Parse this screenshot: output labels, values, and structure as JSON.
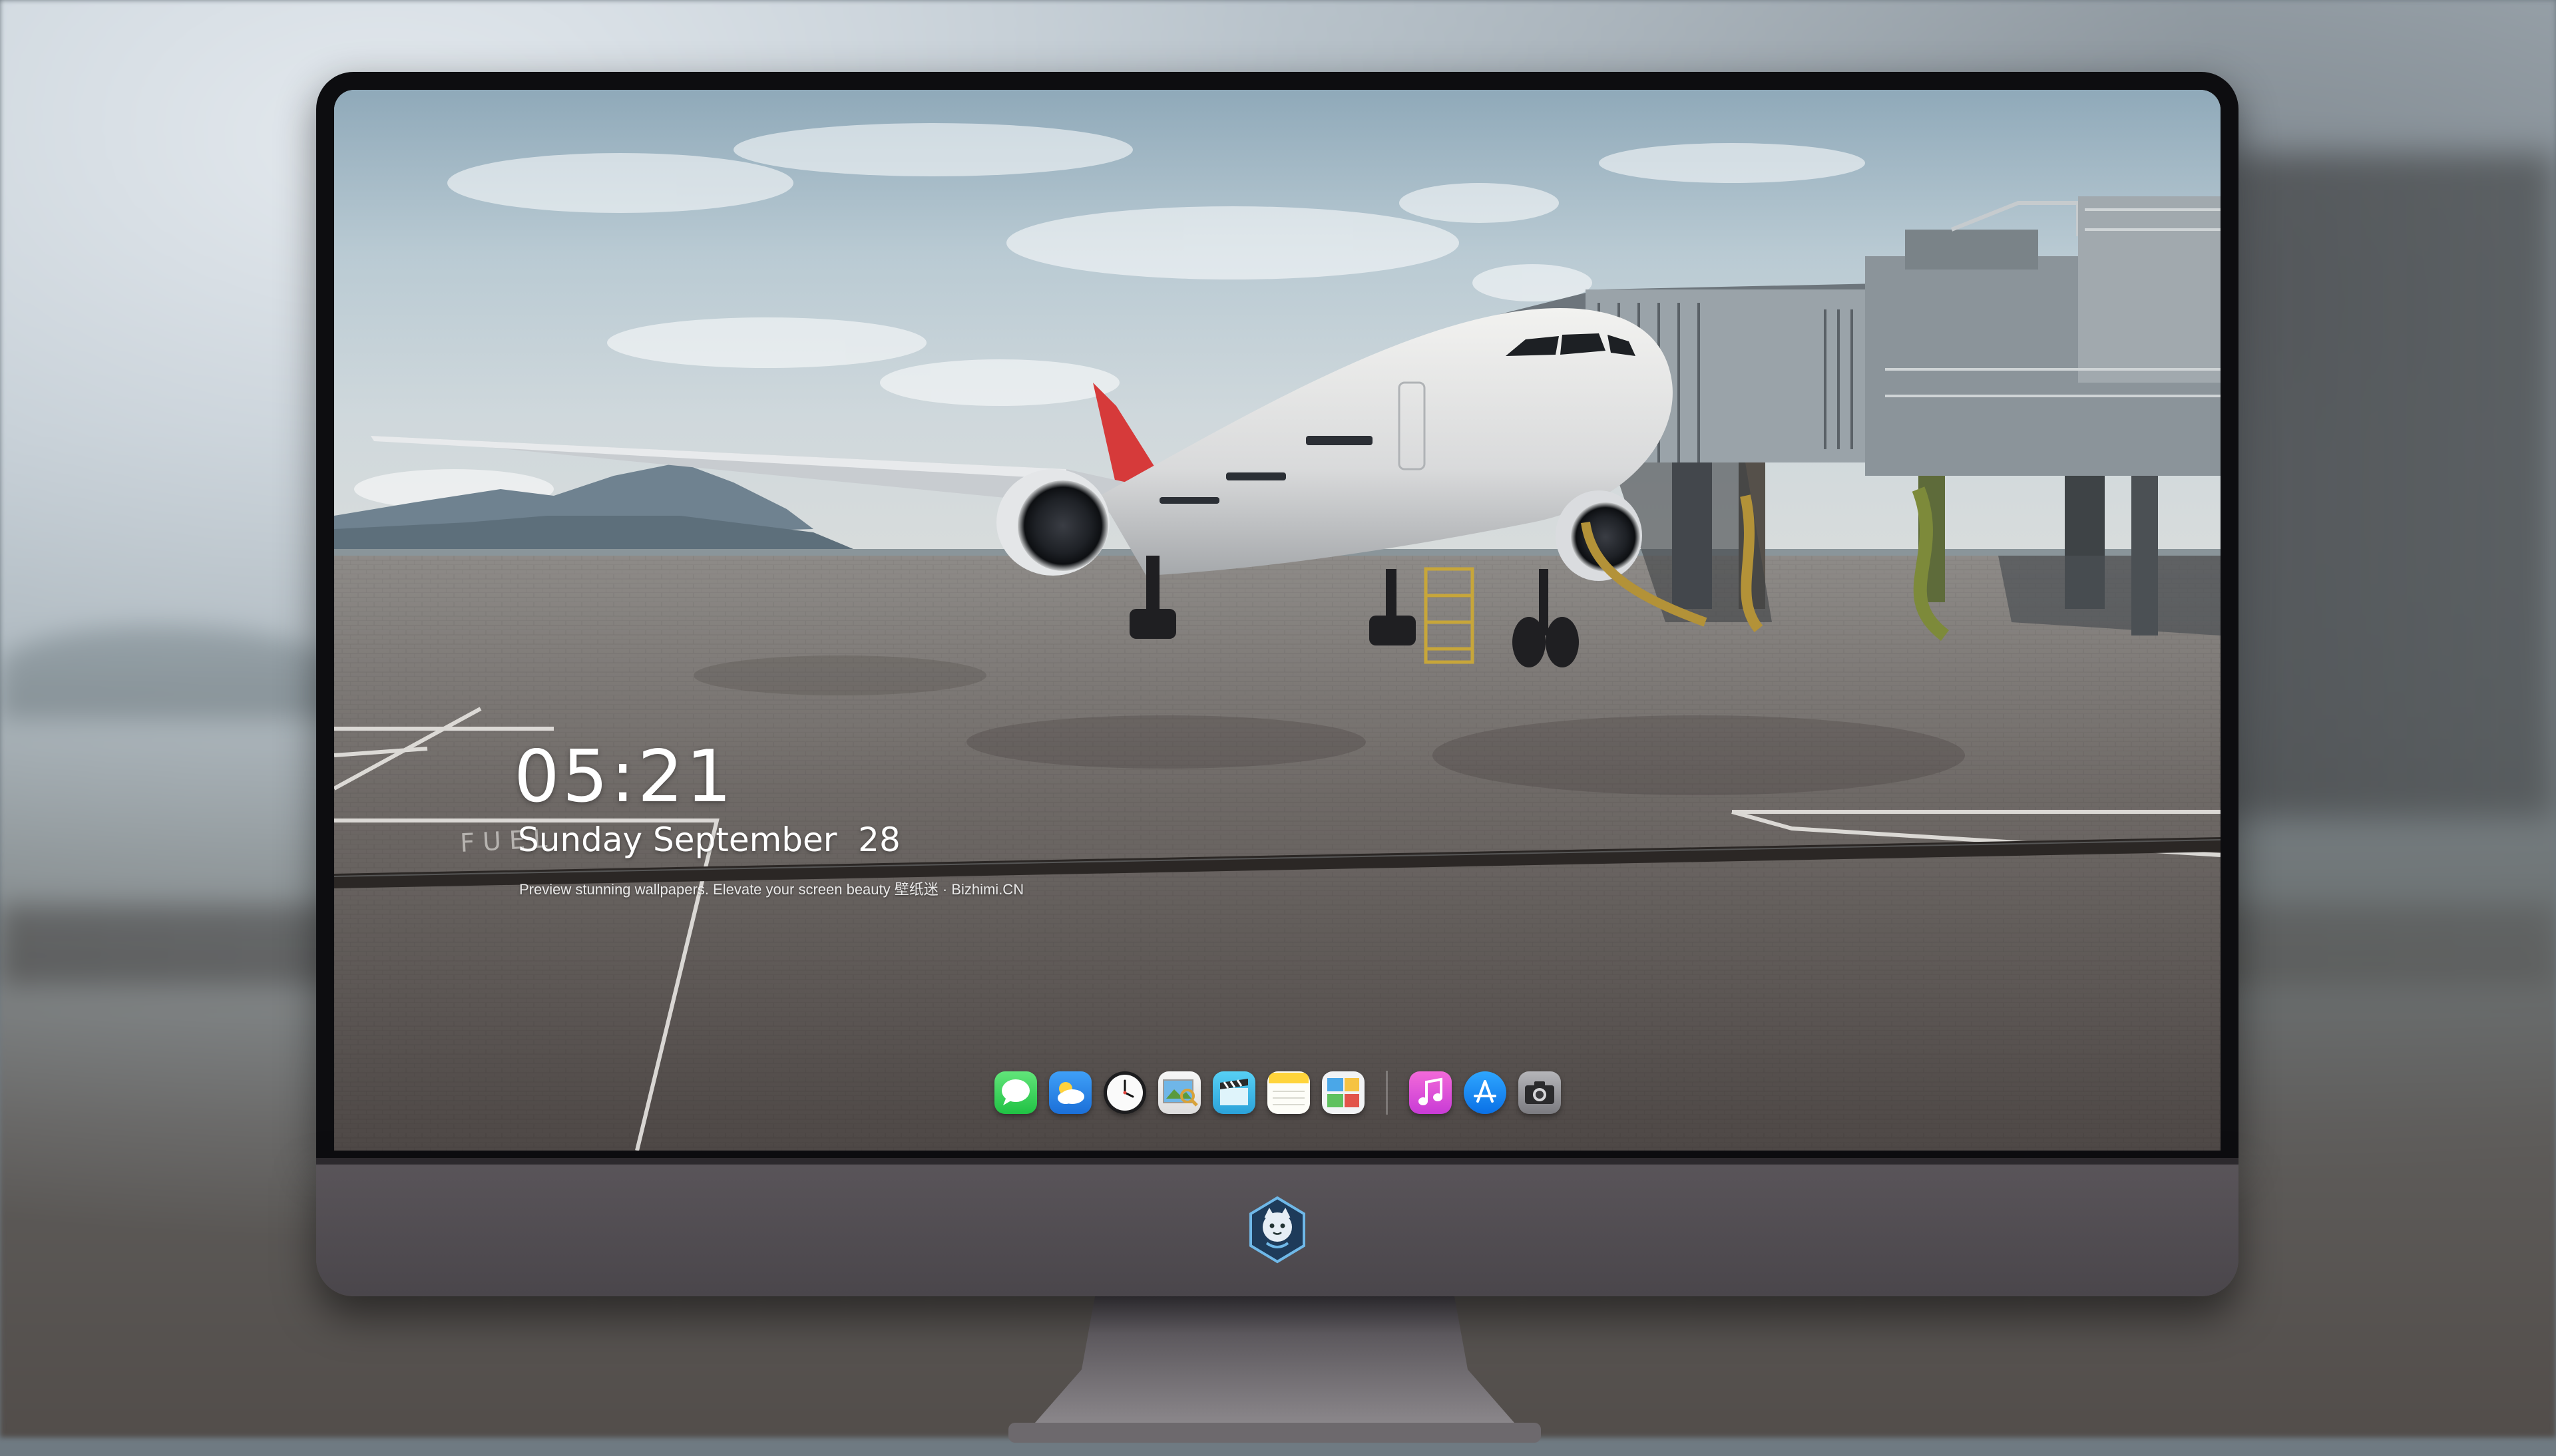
{
  "lockscreen": {
    "time": "05:21",
    "date": "Sunday September  28",
    "tagline": "Preview stunning wallpapers. Elevate your screen beauty  壁纸迷 · Bizhimi.CN"
  },
  "wallpaper": {
    "ground_marking": "FUEL"
  },
  "dock": {
    "apps": [
      {
        "name": "Messages",
        "icon": "messages-icon",
        "color": "#2fd158"
      },
      {
        "name": "Weather",
        "icon": "weather-icon",
        "color": "#2f8cf0"
      },
      {
        "name": "Clock",
        "icon": "clock-icon",
        "color": "#f4f4f4"
      },
      {
        "name": "Preview",
        "icon": "preview-icon",
        "color": "#f0c040"
      },
      {
        "name": "Clips",
        "icon": "clips-icon",
        "color": "#4cc2f0"
      },
      {
        "name": "Notes",
        "icon": "notes-icon",
        "color": "#ffd84a"
      },
      {
        "name": "Photo Gallery",
        "icon": "gallery-icon",
        "color": "#e9ecef"
      },
      {
        "name": "Music",
        "icon": "music-icon",
        "color": "#e94fd0"
      },
      {
        "name": "App Store",
        "icon": "app-store-icon",
        "color": "#1a8cf5"
      },
      {
        "name": "Camera",
        "icon": "camera-icon",
        "color": "#8a8a8e"
      }
    ]
  },
  "colors": {
    "bezel": "#0d0d10",
    "chin": "#4a464b",
    "accent_tail": "#d63a3a"
  }
}
